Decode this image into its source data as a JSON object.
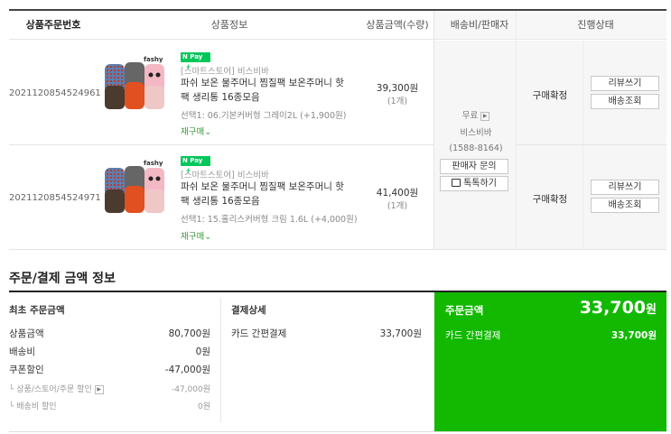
{
  "table_header": {
    "order_no": "상품주문번호",
    "product_info": "상품정보",
    "amount_qty": "상품금액(수량)",
    "shipping_seller": "배송비/판매자",
    "status": "진행상태"
  },
  "orders": [
    {
      "order_no": "2021120854524961",
      "brand_logo": "fashy",
      "npay": "N Pay",
      "store": "[스마트스토어] 비스비바",
      "name_line1": "파쉬 보온 물주머니 찜질팩 보온주머니 핫",
      "name_line2": "팩 생리통 16종모음",
      "option": "선택1: 06.기본커버형 그레이2L (+1,900원)",
      "rebuy": "재구매",
      "price": "39,300원",
      "qty": "(1개)",
      "status": "구매확정",
      "btn_review": "리뷰쓰기",
      "btn_track": "배송조회"
    },
    {
      "order_no": "2021120854524971",
      "brand_logo": "fashy",
      "npay": "N Pay",
      "store": "[스마트스토어] 비스비바",
      "name_line1": "파쉬 보온 물주머니 찜질팩 보온주머니 핫",
      "name_line2": "팩 생리통 16종모음",
      "option": "선택1: 15.홀리스커버형 크림 1.6L (+4,000원)",
      "rebuy": "재구매",
      "price": "41,400원",
      "qty": "(1개)",
      "status": "구매확정",
      "btn_review": "리뷰쓰기",
      "btn_track": "배송조회"
    }
  ],
  "seller": {
    "shipping": "무료",
    "name": "비스비바",
    "phone": "(1588-8164)",
    "inquiry_btn": "판매자 문의",
    "talk_btn": "톡톡하기"
  },
  "summary": {
    "title": "주문/결제 금액 정보",
    "initial_title": "최초 주문금액",
    "rows": [
      {
        "label": "상품금액",
        "value": "80,700원"
      },
      {
        "label": "배송비",
        "value": "0원"
      },
      {
        "label": "쿠폰할인",
        "value": "-47,000원"
      }
    ],
    "sub_rows": [
      {
        "label": "└ 상품/스토어/주문 할인",
        "value": "-47,000원"
      },
      {
        "label": "└ 배송비 할인",
        "value": "0원"
      }
    ],
    "payment_title": "결제상세",
    "payment_method": "카드 간편결제",
    "payment_value": "33,700원",
    "order_total_title": "주문금액",
    "order_total": "33,700",
    "order_total_unit": "원",
    "green_method": "카드 간편결제",
    "green_value": "33,700원"
  },
  "colors": {
    "green": "#12b900",
    "npay": "#03c75a"
  }
}
